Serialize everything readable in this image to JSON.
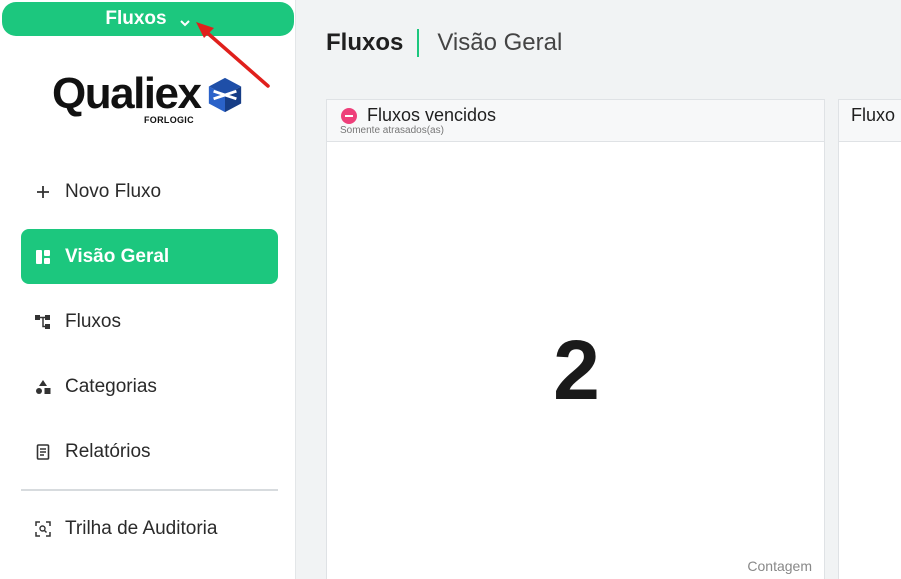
{
  "app_switcher": {
    "label": "Fluxos",
    "icon": "chevron-down-icon"
  },
  "logo": {
    "word": "Qualiex",
    "sub": "FORLOGIC",
    "icon": "cube-icon"
  },
  "sidebar": {
    "items": [
      {
        "label": "Novo Fluxo",
        "icon": "plus-icon",
        "active": false
      },
      {
        "label": "Visão Geral",
        "icon": "dashboard-icon",
        "active": true
      },
      {
        "label": "Fluxos",
        "icon": "flow-icon",
        "active": false
      },
      {
        "label": "Categorias",
        "icon": "shapes-icon",
        "active": false
      },
      {
        "label": "Relatórios",
        "icon": "report-icon",
        "active": false
      },
      {
        "label": "Trilha de Auditoria",
        "icon": "audit-icon",
        "active": false
      }
    ]
  },
  "breadcrumb": {
    "title": "Fluxos",
    "subtitle": "Visão Geral"
  },
  "cards": [
    {
      "title": "Fluxos vencidos",
      "subtitle": "Somente atrasados(as)",
      "value": "2",
      "footer": "Contagem",
      "icon": "stop-icon"
    },
    {
      "title": "Fluxo"
    }
  ],
  "colors": {
    "accent": "#1cc77e",
    "danger": "#ee3f7a",
    "annotation": "#e0201c"
  }
}
